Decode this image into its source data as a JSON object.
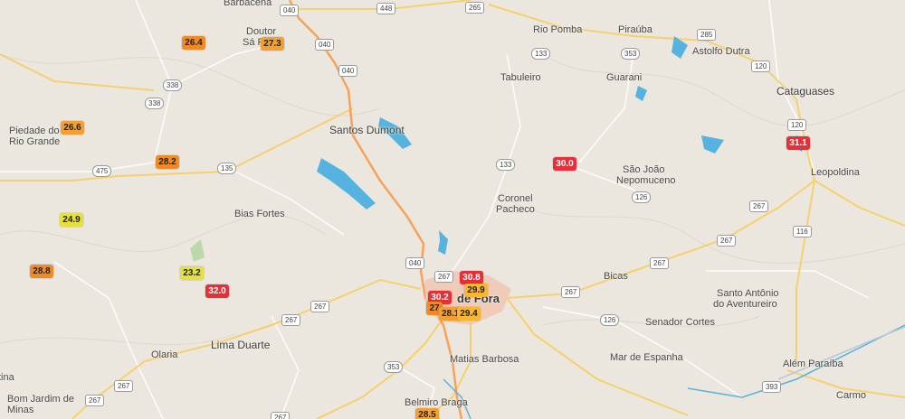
{
  "colors": {
    "land": "#ebe7df",
    "water": "#56b3df",
    "highway": "#f6a25a",
    "road": "#f7d06e",
    "minor_road": "#ffffff",
    "urban": "#f1c6b0",
    "temp_red": "#e5303a",
    "temp_orange": "#f2a032",
    "temp_yellow": "#e6e13a"
  },
  "cities": [
    {
      "id": "barbacena",
      "name": "Barbacena"
    },
    {
      "id": "doutor",
      "name": "Doutor"
    },
    {
      "id": "safora",
      "name": "Sá Fora"
    },
    {
      "id": "riopomba",
      "name": "Rio Pomba"
    },
    {
      "id": "pirauba",
      "name": "Piraúba"
    },
    {
      "id": "astolfo",
      "name": "Astolfo Dutra"
    },
    {
      "id": "tabuleiro",
      "name": "Tabuleiro"
    },
    {
      "id": "guarani",
      "name": "Guarani"
    },
    {
      "id": "cataguases",
      "name": "Cataguases"
    },
    {
      "id": "piedade1",
      "name": "Piedade do"
    },
    {
      "id": "piedade2",
      "name": "Rio Grande"
    },
    {
      "id": "santos",
      "name": "Santos Dumont"
    },
    {
      "id": "leopoldina",
      "name": "Leopoldina"
    },
    {
      "id": "saojoao1",
      "name": "São João"
    },
    {
      "id": "saojoao2",
      "name": "Nepomuceno"
    },
    {
      "id": "coronel1",
      "name": "Coronel"
    },
    {
      "id": "coronel2",
      "name": "Pacheco"
    },
    {
      "id": "biasfortes",
      "name": "Bias Fortes"
    },
    {
      "id": "juizdefora",
      "name": "de Fora"
    },
    {
      "id": "bicas",
      "name": "Bicas"
    },
    {
      "id": "santoantonio1",
      "name": "Santo Antônio"
    },
    {
      "id": "santoantonio2",
      "name": "do Aventureiro"
    },
    {
      "id": "senador",
      "name": "Senador Cortes"
    },
    {
      "id": "olaria",
      "name": "Olaria"
    },
    {
      "id": "limaduarte",
      "name": "Lima Duarte"
    },
    {
      "id": "matias",
      "name": "Matias Barbosa"
    },
    {
      "id": "marespanha",
      "name": "Mar de Espanha"
    },
    {
      "id": "alemparaiba",
      "name": "Além Paraíba"
    },
    {
      "id": "carmo",
      "name": "Carmo"
    },
    {
      "id": "bomjardim1",
      "name": "Bom Jardim de"
    },
    {
      "id": "bomjardim2",
      "name": "Minas"
    },
    {
      "id": "belmiro",
      "name": "Belmiro Braga"
    },
    {
      "id": "tina",
      "name": "tina"
    }
  ],
  "shields": [
    {
      "id": "s040a",
      "label": "040"
    },
    {
      "id": "s448",
      "label": "448"
    },
    {
      "id": "s265",
      "label": "265"
    },
    {
      "id": "s285",
      "label": "285"
    },
    {
      "id": "s040b",
      "label": "040"
    },
    {
      "id": "s040c",
      "label": "040"
    },
    {
      "id": "s133a",
      "label": "133"
    },
    {
      "id": "s353a",
      "label": "353"
    },
    {
      "id": "s120a",
      "label": "120"
    },
    {
      "id": "s338a",
      "label": "338"
    },
    {
      "id": "s338b",
      "label": "338"
    },
    {
      "id": "s120b",
      "label": "120"
    },
    {
      "id": "s475",
      "label": "475"
    },
    {
      "id": "s135",
      "label": "135"
    },
    {
      "id": "s133b",
      "label": "133"
    },
    {
      "id": "s126a",
      "label": "126"
    },
    {
      "id": "s267a",
      "label": "267"
    },
    {
      "id": "s116",
      "label": "116"
    },
    {
      "id": "s267b",
      "label": "267"
    },
    {
      "id": "s040d",
      "label": "040"
    },
    {
      "id": "s267c",
      "label": "267"
    },
    {
      "id": "s267d",
      "label": "267"
    },
    {
      "id": "s267e",
      "label": "267"
    },
    {
      "id": "s267f",
      "label": "267"
    },
    {
      "id": "s126b",
      "label": "126"
    },
    {
      "id": "s267g",
      "label": "267"
    },
    {
      "id": "s353b",
      "label": "353"
    },
    {
      "id": "s393",
      "label": "393"
    },
    {
      "id": "s267h",
      "label": "267"
    },
    {
      "id": "s267i",
      "label": "267"
    },
    {
      "id": "s267j",
      "label": "267"
    }
  ],
  "temperatures": [
    {
      "id": "t1",
      "value": "26.4",
      "level": "dark"
    },
    {
      "id": "t2",
      "value": "27.3",
      "level": "orange"
    },
    {
      "id": "t3",
      "value": "26.6",
      "level": "orange"
    },
    {
      "id": "t4",
      "value": "28.2",
      "level": "dark"
    },
    {
      "id": "t5",
      "value": "31.1",
      "level": "red"
    },
    {
      "id": "t6",
      "value": "30.0",
      "level": "red"
    },
    {
      "id": "t7",
      "value": "24.9",
      "level": "yellow"
    },
    {
      "id": "t8",
      "value": "28.8",
      "level": "dark"
    },
    {
      "id": "t9",
      "value": "23.2",
      "level": "yellow"
    },
    {
      "id": "t10",
      "value": "32.0",
      "level": "red"
    },
    {
      "id": "t11",
      "value": "30.8",
      "level": "red"
    },
    {
      "id": "t12",
      "value": "29.9",
      "level": "amber"
    },
    {
      "id": "t13",
      "value": "30.2",
      "level": "red"
    },
    {
      "id": "t14",
      "value": "27",
      "level": "dark"
    },
    {
      "id": "t15",
      "value": "28.1",
      "level": "orange"
    },
    {
      "id": "t16",
      "value": "29.4",
      "level": "amber"
    },
    {
      "id": "t17",
      "value": "28.5",
      "level": "orange"
    }
  ]
}
